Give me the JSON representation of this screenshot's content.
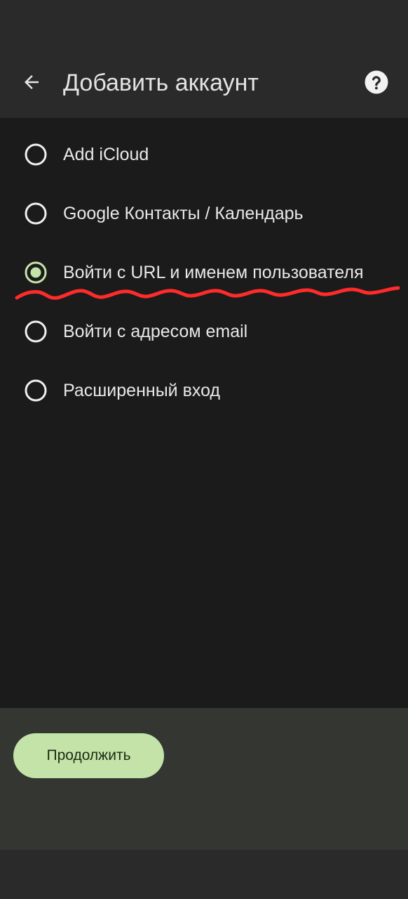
{
  "app_bar": {
    "title": "Добавить аккаунт",
    "back_icon": "arrow-left-icon",
    "help_icon": "help-circle-icon"
  },
  "options": [
    {
      "label": "Add iCloud",
      "selected": false
    },
    {
      "label": "Google Контакты / Календарь",
      "selected": false
    },
    {
      "label": "Войти с URL и именем пользователя",
      "selected": true
    },
    {
      "label": "Войти с адресом email",
      "selected": false
    },
    {
      "label": "Расширенный вход",
      "selected": false
    }
  ],
  "annotation": {
    "type": "hand-drawn-underline",
    "color": "#ff2b2b",
    "target_option": 2
  },
  "footer": {
    "continue_label": "Продолжить"
  },
  "colors": {
    "background": "#1b1b1b",
    "app_bar": "#2a2a2a",
    "accent": "#c4e3a8",
    "footer": "#343632"
  }
}
